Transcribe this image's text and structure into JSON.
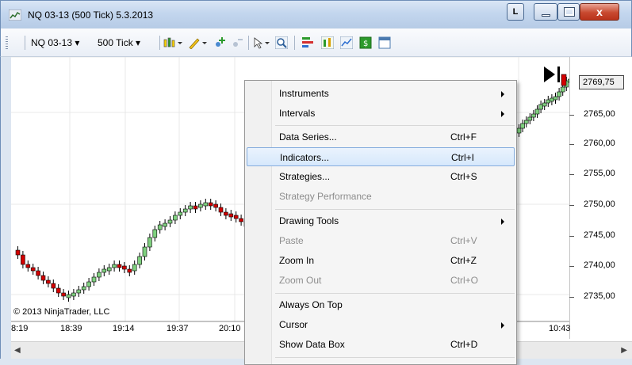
{
  "window": {
    "title": "NQ 03-13 (500 Tick)  5.3.2013",
    "l_button": "L",
    "close_glyph": "x"
  },
  "toolbar": {
    "instrument": "NQ 03-13",
    "interval": "500 Tick"
  },
  "chart": {
    "copyright": "© 2013 NinjaTrader, LLC",
    "last_price": "2769,75",
    "price_labels": [
      "2765,00",
      "2760,00",
      "2755,00",
      "2750,00",
      "2745,00",
      "2740,00",
      "2735,00"
    ],
    "time_labels": [
      "8:19",
      "18:39",
      "19:14",
      "19:37",
      "20:10",
      "10:43"
    ],
    "up_color": "#7fd17f",
    "down_color": "#d40000"
  },
  "menu": {
    "items": [
      {
        "label": "Instruments",
        "shortcut": "",
        "submenu": true,
        "disabled": false
      },
      {
        "label": "Intervals",
        "shortcut": "",
        "submenu": true,
        "disabled": false
      },
      {
        "label": "Data Series...",
        "shortcut": "Ctrl+F",
        "submenu": false,
        "disabled": false
      },
      {
        "label": "Indicators...",
        "shortcut": "Ctrl+I",
        "submenu": false,
        "disabled": false,
        "highlighted": true
      },
      {
        "label": "Strategies...",
        "shortcut": "Ctrl+S",
        "submenu": false,
        "disabled": false
      },
      {
        "label": "Strategy Performance",
        "shortcut": "",
        "submenu": false,
        "disabled": true
      },
      {
        "label": "Drawing Tools",
        "shortcut": "",
        "submenu": true,
        "disabled": false
      },
      {
        "label": "Paste",
        "shortcut": "Ctrl+V",
        "submenu": false,
        "disabled": true
      },
      {
        "label": "Zoom In",
        "shortcut": "Ctrl+Z",
        "submenu": false,
        "disabled": false
      },
      {
        "label": "Zoom Out",
        "shortcut": "Ctrl+O",
        "submenu": false,
        "disabled": true
      },
      {
        "label": "Always On Top",
        "shortcut": "",
        "submenu": false,
        "disabled": false
      },
      {
        "label": "Cursor",
        "shortcut": "",
        "submenu": true,
        "disabled": false
      },
      {
        "label": "Show Data Box",
        "shortcut": "Ctrl+D",
        "submenu": false,
        "disabled": false
      }
    ]
  }
}
